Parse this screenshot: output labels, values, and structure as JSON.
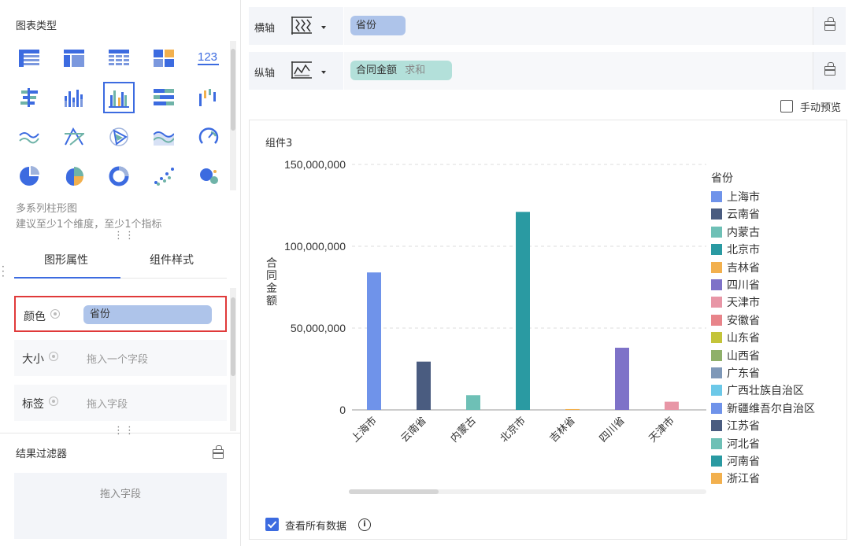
{
  "left_panel": {
    "chart_type_title": "图表类型",
    "chart_type_desc": "多系列柱形图",
    "chart_type_hint": "建议至少1个维度，至少1个指标",
    "icon_123_text": "123",
    "chart_types": [
      "detail-table-icon",
      "group-table-icon",
      "cross-table-icon",
      "kpi-card-icon",
      "number-card-icon",
      "grouped-bar-icon",
      "stacked-column-icon",
      "multi-series-column-icon",
      "percent-bar-icon",
      "waterfall-icon",
      "line-icon",
      "radar-icon",
      "polygon-radar-icon",
      "area-icon",
      "gauge-icon",
      "pie-icon",
      "rose-pie-icon",
      "ring-icon",
      "scatter-icon",
      "bubble-icon"
    ],
    "selected_chart_type": "multi-series-column-icon",
    "tabs": [
      {
        "label": "图形属性",
        "active": true
      },
      {
        "label": "组件样式",
        "active": false
      }
    ],
    "properties": [
      {
        "label": "颜色",
        "value": "省份",
        "placeholder": ""
      },
      {
        "label": "大小",
        "value": "",
        "placeholder": "拖入一个字段"
      },
      {
        "label": "标签",
        "value": "",
        "placeholder": "拖入字段"
      }
    ],
    "filter_title": "结果过滤器",
    "filter_placeholder": "拖入字段"
  },
  "axes": {
    "x": {
      "label": "横轴",
      "field": "省份"
    },
    "y": {
      "label": "纵轴",
      "field": "合同金额",
      "aggregation": "求和"
    }
  },
  "manual_preview_label": "手动预览",
  "card": {
    "title": "组件3",
    "see_all_label": "查看所有数据"
  },
  "colors": {
    "accent": "#3c6be0",
    "x_pill": "#aec4ea",
    "y_pill": "#b3e0da"
  },
  "chart_data": {
    "type": "bar",
    "categories": [
      "上海市",
      "云南省",
      "内蒙古",
      "北京市",
      "吉林省",
      "四川省",
      "天津市"
    ],
    "values": [
      84000000,
      29500000,
      9000000,
      121000000,
      500000,
      38000000,
      5000000
    ],
    "colors": [
      "#6f93ea",
      "#4a5c80",
      "#6ec0b6",
      "#2a9aa2",
      "#f2b04e",
      "#7e72c8",
      "#e896a6"
    ],
    "ylabel": "合同金额",
    "ylim": [
      0,
      150000000
    ],
    "yticks": [
      0,
      50000000,
      100000000,
      150000000
    ],
    "ytick_labels": [
      "0",
      "50,000,000",
      "100,000,000",
      "150,000,000"
    ],
    "grid": true,
    "legend_position": "right",
    "legend_title": "省份",
    "legend": [
      {
        "name": "上海市",
        "color": "#6f93ea"
      },
      {
        "name": "云南省",
        "color": "#4a5c80"
      },
      {
        "name": "内蒙古",
        "color": "#6ec0b6"
      },
      {
        "name": "北京市",
        "color": "#2a9aa2"
      },
      {
        "name": "吉林省",
        "color": "#f2b04e"
      },
      {
        "name": "四川省",
        "color": "#7e72c8"
      },
      {
        "name": "天津市",
        "color": "#e896a6"
      },
      {
        "name": "安徽省",
        "color": "#e8848a"
      },
      {
        "name": "山东省",
        "color": "#c4c43a"
      },
      {
        "name": "山西省",
        "color": "#8fb06a"
      },
      {
        "name": "广东省",
        "color": "#7e98b8"
      },
      {
        "name": "广西壮族自治区",
        "color": "#6cc8e8"
      },
      {
        "name": "新疆维吾尔自治区",
        "color": "#6f93ea"
      },
      {
        "name": "江苏省",
        "color": "#4a5c80"
      },
      {
        "name": "河北省",
        "color": "#6ec0b6"
      },
      {
        "name": "河南省",
        "color": "#2a9aa2"
      },
      {
        "name": "浙江省",
        "color": "#f2b04e"
      }
    ]
  }
}
